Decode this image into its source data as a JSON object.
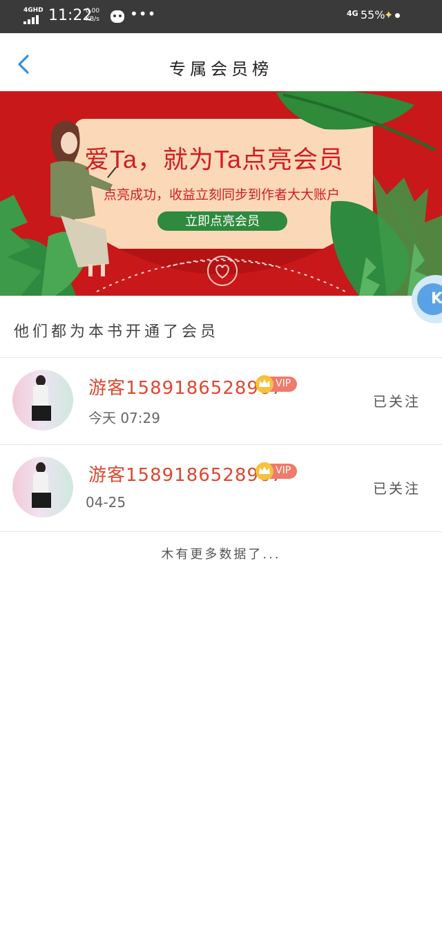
{
  "status_bar": {
    "network": "4GHD",
    "time": "11:22",
    "speed_value": "0.00",
    "speed_unit": "KB/s",
    "more": "•••",
    "network_right": "4G",
    "battery": "55%"
  },
  "header": {
    "title": "专属会员榜"
  },
  "banner": {
    "headline": "爱Ta，就为Ta点亮会员",
    "subtitle": "点亮成功，收益立刻同步到作者大大账户",
    "cta_label": "立即点亮会员"
  },
  "floating_button": {
    "label": "K"
  },
  "section": {
    "title": "他们都为本书开通了会员"
  },
  "members": [
    {
      "name": "游客15891865​28967",
      "badge": "VIP",
      "date": "今天 07:29",
      "follow_label": "已关注"
    },
    {
      "name": "游客15891865​28967",
      "badge": "VIP",
      "date": "04-25",
      "follow_label": "已关注"
    }
  ],
  "footer": {
    "no_more": "木有更多数据了..."
  },
  "colors": {
    "banner_red": "#c8181a",
    "name_red": "#e0462f",
    "accent_blue": "#2f8fe0",
    "cta_green": "#2e8a3e",
    "vip_gold": "#f7c23a"
  }
}
